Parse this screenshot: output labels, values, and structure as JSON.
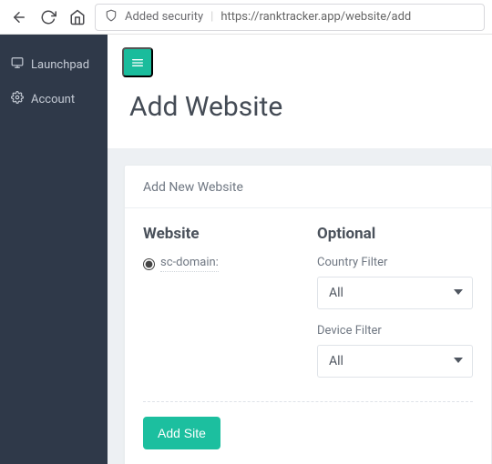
{
  "browser": {
    "security_label": "Added security",
    "url": "https://ranktracker.app/website/add"
  },
  "sidebar": {
    "items": [
      {
        "label": "Launchpad"
      },
      {
        "label": "Account"
      }
    ]
  },
  "page": {
    "title": "Add Website"
  },
  "card": {
    "heading": "Add New Website",
    "website_section_title": "Website",
    "website_radio_label": "sc-domain:",
    "optional_section_title": "Optional",
    "country_filter_label": "Country Filter",
    "country_filter_value": "All",
    "device_filter_label": "Device Filter",
    "device_filter_value": "All",
    "submit_label": "Add Site"
  }
}
